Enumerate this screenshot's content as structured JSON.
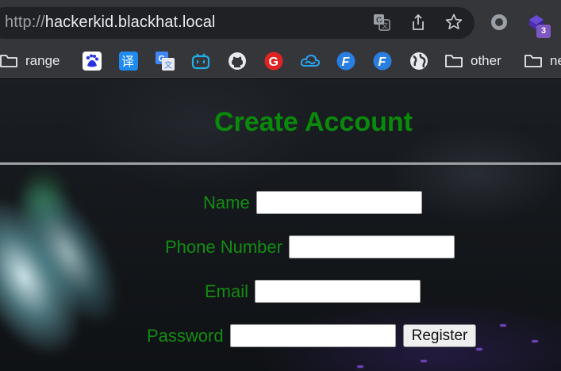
{
  "browser": {
    "url_scheme": "http://",
    "url_host": "hackerkid.blackhat.local",
    "extension_badge": "3",
    "toolbar_icons": [
      "translate-icon",
      "share-icon",
      "bookmark-star-icon",
      "profile-circle-icon",
      "extension-icon"
    ]
  },
  "bookmarks": [
    {
      "type": "folder",
      "label": "range"
    },
    {
      "type": "icon",
      "icon": "baidu-icon"
    },
    {
      "type": "icon",
      "icon": "fanyi-icon",
      "glyph": "译"
    },
    {
      "type": "icon",
      "icon": "google-translate-icon"
    },
    {
      "type": "icon",
      "icon": "bilibili-icon"
    },
    {
      "type": "icon",
      "icon": "github-icon"
    },
    {
      "type": "icon",
      "icon": "g-red-icon",
      "glyph": "G"
    },
    {
      "type": "icon",
      "icon": "cloud-icon"
    },
    {
      "type": "icon",
      "icon": "f-blue-icon-1",
      "glyph": "F"
    },
    {
      "type": "icon",
      "icon": "f-blue-icon-2",
      "glyph": "F"
    },
    {
      "type": "icon",
      "icon": "globe-icon"
    },
    {
      "type": "folder",
      "label": "other"
    },
    {
      "type": "folder",
      "label": "ne"
    }
  ],
  "page": {
    "title": "Create Account",
    "form": {
      "name_label": "Name",
      "phone_label": "Phone Number",
      "email_label": "Email",
      "password_label": "Password",
      "name_value": "",
      "phone_value": "",
      "email_value": "",
      "password_value": "",
      "register_label": "Register"
    }
  },
  "colors": {
    "heading": "#0a8a0a",
    "label": "#138c13",
    "chrome": "#35363a",
    "omnibox": "#202124"
  }
}
